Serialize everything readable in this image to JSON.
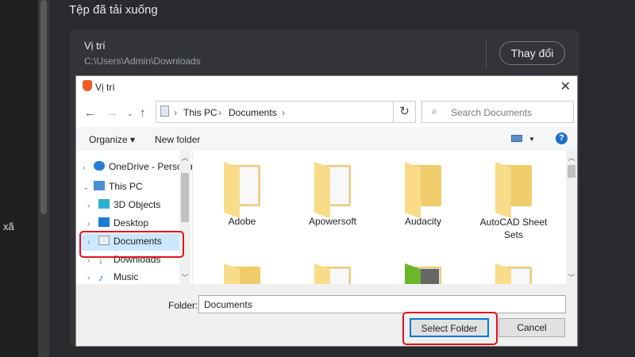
{
  "background": {
    "side_text": "xã",
    "title": "Tệp đã tải xuống",
    "location_label": "Vị trí",
    "location_path": "C:\\Users\\Admin\\Downloads",
    "change_button": "Thay đổi"
  },
  "dialog": {
    "title": "Vị trí",
    "breadcrumb": [
      "This PC",
      "Documents"
    ],
    "search_placeholder": "Search Documents",
    "organize": "Organize ▾",
    "new_folder": "New folder",
    "help": "?",
    "nav_items": [
      {
        "label": "OneDrive - Personal",
        "chev": "›"
      },
      {
        "label": "This PC",
        "chev": "⌄"
      },
      {
        "label": "3D Objects",
        "chev": "›"
      },
      {
        "label": "Desktop",
        "chev": "›"
      },
      {
        "label": "Documents",
        "chev": "›"
      },
      {
        "label": "Downloads",
        "chev": "›"
      },
      {
        "label": "Music",
        "chev": "›"
      }
    ],
    "folders": [
      "Adobe",
      "Apowersoft",
      "Audacity",
      "AutoCAD Sheet Sets"
    ],
    "folder_label": "Folder:",
    "folder_value": "Documents",
    "select_button": "Select Folder",
    "cancel_button": "Cancel"
  },
  "colors": {
    "highlight": "#e0141e",
    "selection": "#cce8ff"
  }
}
